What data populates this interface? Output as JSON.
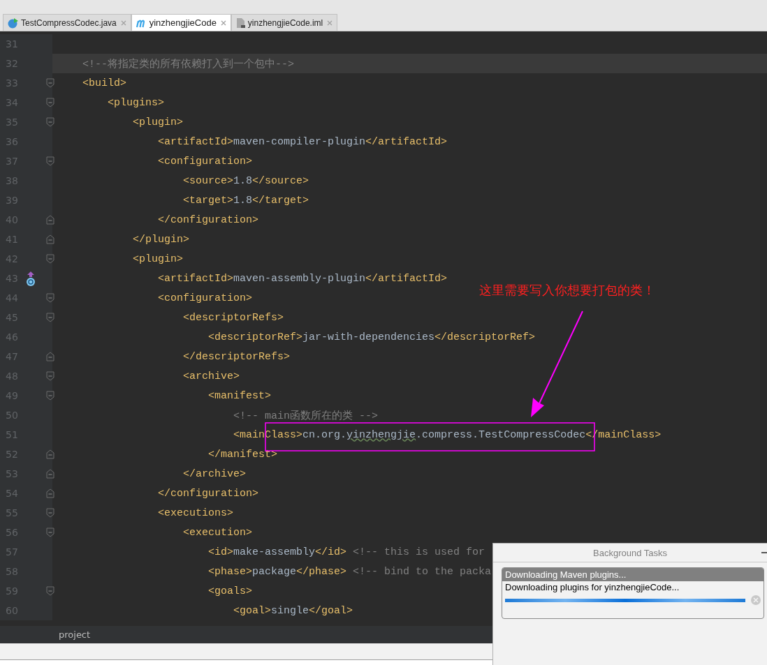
{
  "tabs": [
    {
      "label": "TestCompressCodec.java",
      "kind": "java",
      "selected": false
    },
    {
      "label": "yinzhengjieCode",
      "kind": "maven",
      "selected": true
    },
    {
      "label": "yinzhengjieCode.iml",
      "kind": "file",
      "selected": false
    }
  ],
  "editor": {
    "lines": [
      {
        "number": "31",
        "current": false,
        "fold_start": false,
        "fold_end": false,
        "override": false
      },
      {
        "number": "32",
        "current": true,
        "fold_start": false,
        "fold_end": false,
        "override": false,
        "tokens": [
          {
            "kind": "comment",
            "text": "    <!--将指定类的所有依赖打入到一个包中-->"
          }
        ]
      },
      {
        "number": "33",
        "current": false,
        "fold_start": true,
        "fold_end": false,
        "override": false,
        "tokens": [
          {
            "kind": "tag",
            "text": "    <build>"
          }
        ]
      },
      {
        "number": "34",
        "current": false,
        "fold_start": true,
        "fold_end": false,
        "override": false,
        "tokens": [
          {
            "kind": "tag",
            "text": "        <plugins>"
          }
        ]
      },
      {
        "number": "35",
        "current": false,
        "fold_start": true,
        "fold_end": false,
        "override": false,
        "tokens": [
          {
            "kind": "tag",
            "text": "            <plugin>"
          }
        ]
      },
      {
        "number": "36",
        "current": false,
        "fold_start": false,
        "fold_end": false,
        "override": false,
        "tokens": [
          {
            "kind": "tag",
            "text": "                <artifactId>"
          },
          {
            "kind": "text",
            "text": "maven-compiler-plugin"
          },
          {
            "kind": "tag",
            "text": "</artifactId>"
          }
        ]
      },
      {
        "number": "37",
        "current": false,
        "fold_start": true,
        "fold_end": false,
        "override": false,
        "tokens": [
          {
            "kind": "tag",
            "text": "                <configuration>"
          }
        ]
      },
      {
        "number": "38",
        "current": false,
        "fold_start": false,
        "fold_end": false,
        "override": false,
        "tokens": [
          {
            "kind": "tag",
            "text": "                    <source>"
          },
          {
            "kind": "text",
            "text": "1.8"
          },
          {
            "kind": "tag",
            "text": "</source>"
          }
        ]
      },
      {
        "number": "39",
        "current": false,
        "fold_start": false,
        "fold_end": false,
        "override": false,
        "tokens": [
          {
            "kind": "tag",
            "text": "                    <target>"
          },
          {
            "kind": "text",
            "text": "1.8"
          },
          {
            "kind": "tag",
            "text": "</target>"
          }
        ]
      },
      {
        "number": "40",
        "current": false,
        "fold_start": false,
        "fold_end": true,
        "override": false,
        "tokens": [
          {
            "kind": "tag",
            "text": "                </configuration>"
          }
        ]
      },
      {
        "number": "41",
        "current": false,
        "fold_start": false,
        "fold_end": true,
        "override": false,
        "tokens": [
          {
            "kind": "tag",
            "text": "            </plugin>"
          }
        ]
      },
      {
        "number": "42",
        "current": false,
        "fold_start": true,
        "fold_end": false,
        "override": false,
        "tokens": [
          {
            "kind": "tag",
            "text": "            <plugin>"
          }
        ]
      },
      {
        "number": "43",
        "current": false,
        "fold_start": false,
        "fold_end": false,
        "override": true,
        "tokens": [
          {
            "kind": "tag",
            "text": "                <artifactId>"
          },
          {
            "kind": "text",
            "text": "maven-assembly-plugin"
          },
          {
            "kind": "tag",
            "text": "</artifactId>"
          }
        ]
      },
      {
        "number": "44",
        "current": false,
        "fold_start": true,
        "fold_end": false,
        "override": false,
        "tokens": [
          {
            "kind": "tag",
            "text": "                <configuration>"
          }
        ]
      },
      {
        "number": "45",
        "current": false,
        "fold_start": true,
        "fold_end": false,
        "override": false,
        "tokens": [
          {
            "kind": "tag",
            "text": "                    <descriptorRefs>"
          }
        ]
      },
      {
        "number": "46",
        "current": false,
        "fold_start": false,
        "fold_end": false,
        "override": false,
        "tokens": [
          {
            "kind": "tag",
            "text": "                        <descriptorRef>"
          },
          {
            "kind": "text",
            "text": "jar-with-dependencies"
          },
          {
            "kind": "tag",
            "text": "</descriptorRef>"
          }
        ]
      },
      {
        "number": "47",
        "current": false,
        "fold_start": false,
        "fold_end": true,
        "override": false,
        "tokens": [
          {
            "kind": "tag",
            "text": "                    </descriptorRefs>"
          }
        ]
      },
      {
        "number": "48",
        "current": false,
        "fold_start": true,
        "fold_end": false,
        "override": false,
        "tokens": [
          {
            "kind": "tag",
            "text": "                    <archive>"
          }
        ]
      },
      {
        "number": "49",
        "current": false,
        "fold_start": true,
        "fold_end": false,
        "override": false,
        "tokens": [
          {
            "kind": "tag",
            "text": "                        <manifest>"
          }
        ]
      },
      {
        "number": "50",
        "current": false,
        "fold_start": false,
        "fold_end": false,
        "override": false,
        "tokens": [
          {
            "kind": "comment",
            "text": "                            <!-- main函数所在的类 -->"
          }
        ]
      },
      {
        "number": "51",
        "current": false,
        "fold_start": false,
        "fold_end": false,
        "override": false,
        "tokens": [
          {
            "kind": "tag",
            "text": "                            <mainClass>"
          },
          {
            "kind": "text",
            "text": "cn.org."
          },
          {
            "kind": "typo",
            "text": "yinzhengjie"
          },
          {
            "kind": "text",
            "text": ".compress.TestCompressCodec"
          },
          {
            "kind": "tag",
            "text": "</mainClass>"
          }
        ]
      },
      {
        "number": "52",
        "current": false,
        "fold_start": false,
        "fold_end": true,
        "override": false,
        "tokens": [
          {
            "kind": "tag",
            "text": "                        </manifest>"
          }
        ]
      },
      {
        "number": "53",
        "current": false,
        "fold_start": false,
        "fold_end": true,
        "override": false,
        "tokens": [
          {
            "kind": "tag",
            "text": "                    </archive>"
          }
        ]
      },
      {
        "number": "54",
        "current": false,
        "fold_start": false,
        "fold_end": true,
        "override": false,
        "tokens": [
          {
            "kind": "tag",
            "text": "                </configuration>"
          }
        ]
      },
      {
        "number": "55",
        "current": false,
        "fold_start": true,
        "fold_end": false,
        "override": false,
        "tokens": [
          {
            "kind": "tag",
            "text": "                <executions>"
          }
        ]
      },
      {
        "number": "56",
        "current": false,
        "fold_start": true,
        "fold_end": false,
        "override": false,
        "tokens": [
          {
            "kind": "tag",
            "text": "                    <execution>"
          }
        ]
      },
      {
        "number": "57",
        "current": false,
        "fold_start": false,
        "fold_end": false,
        "override": false,
        "tokens": [
          {
            "kind": "tag",
            "text": "                        <id>"
          },
          {
            "kind": "text",
            "text": "make-assembly"
          },
          {
            "kind": "tag",
            "text": "</id>"
          },
          {
            "kind": "comment",
            "text": " <!-- this is used for"
          }
        ]
      },
      {
        "number": "58",
        "current": false,
        "fold_start": false,
        "fold_end": false,
        "override": false,
        "tokens": [
          {
            "kind": "tag",
            "text": "                        <phase>"
          },
          {
            "kind": "text",
            "text": "package"
          },
          {
            "kind": "tag",
            "text": "</phase>"
          },
          {
            "kind": "comment",
            "text": " <!-- bind to the packa"
          }
        ]
      },
      {
        "number": "59",
        "current": false,
        "fold_start": true,
        "fold_end": false,
        "override": false,
        "tokens": [
          {
            "kind": "tag",
            "text": "                        <goals>"
          }
        ]
      },
      {
        "number": "60",
        "current": false,
        "fold_start": false,
        "fold_end": false,
        "override": false,
        "tokens": [
          {
            "kind": "tag",
            "text": "                            <goal>"
          },
          {
            "kind": "text",
            "text": "single"
          },
          {
            "kind": "tag",
            "text": "</goal>"
          }
        ]
      }
    ]
  },
  "annotation": {
    "text": "这里需要写入你想要打包的类！"
  },
  "breadcrumb": "project",
  "background_tasks": {
    "title": "Background Tasks",
    "task": {
      "title": "Downloading Maven plugins...",
      "detail": "Downloading plugins for yinzhengjieCode...",
      "level": 1
    }
  }
}
